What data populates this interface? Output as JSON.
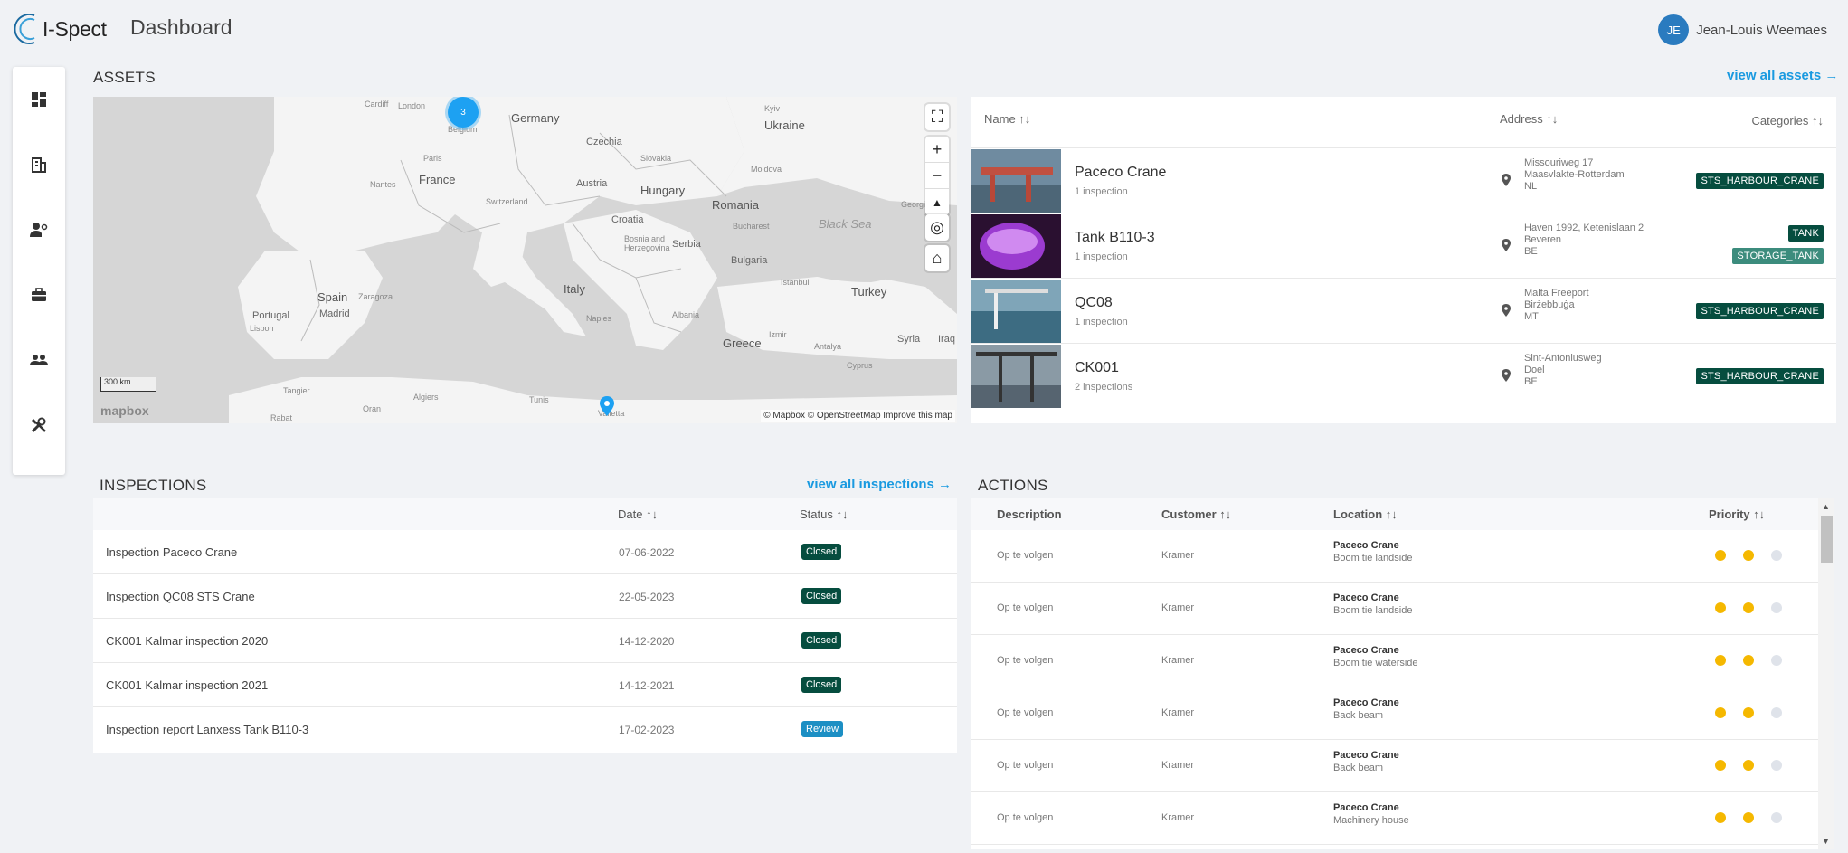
{
  "app": {
    "name": "I-Spect",
    "page_title": "Dashboard"
  },
  "user": {
    "initials": "JE",
    "name": "Jean-Louis Weemaes"
  },
  "sidebar": {
    "items": [
      {
        "name": "dashboard-icon",
        "glyph": "▦"
      },
      {
        "name": "buildings-icon",
        "glyph": "▥"
      },
      {
        "name": "user-settings-icon",
        "glyph": "👤"
      },
      {
        "name": "briefcase-icon",
        "glyph": "💼"
      },
      {
        "name": "users-icon",
        "glyph": "👥"
      },
      {
        "name": "tools-icon",
        "glyph": "🛠"
      }
    ]
  },
  "assets": {
    "title": "ASSETS",
    "view_all": "view all assets →",
    "columns": {
      "name": "Name ↑↓",
      "address": "Address ↑↓",
      "categories": "Categories ↑↓"
    },
    "rows": [
      {
        "name": "Paceco Crane",
        "sub": "1 inspection",
        "address": [
          "Missouriweg 17",
          "Maasvlakte-Rotterdam",
          "NL"
        ],
        "tags": [
          "STS_HARBOUR_CRANE"
        ]
      },
      {
        "name": "Tank B110-3",
        "sub": "1 inspection",
        "address": [
          "Haven 1992, Ketenislaan 2",
          "Beveren",
          "BE"
        ],
        "tags": [
          "TANK",
          "STORAGE_TANK"
        ]
      },
      {
        "name": "QC08",
        "sub": "1 inspection",
        "address": [
          "Malta Freeport",
          "Birżebbuġa",
          "MT"
        ],
        "tags": [
          "STS_HARBOUR_CRANE"
        ]
      },
      {
        "name": "CK001",
        "sub": "2 inspections",
        "address": [
          "Sint-Antoniusweg",
          "Doel",
          "BE"
        ],
        "tags": [
          "STS_HARBOUR_CRANE"
        ]
      }
    ]
  },
  "map": {
    "cluster_count": "3",
    "scale": "300 km",
    "logo": "mapbox",
    "attribution": "© Mapbox © OpenStreetMap  Improve this map",
    "labels": {
      "germany": "Germany",
      "ukraine": "Ukraine",
      "belgium": "Belgium",
      "london": "London",
      "cardiff": "Cardiff",
      "czechia": "Czechia",
      "slovakia": "Slovakia",
      "moldova": "Moldova",
      "paris": "Paris",
      "france": "France",
      "nantes": "Nantes",
      "austria": "Austria",
      "hungary": "Hungary",
      "switzerland": "Switzerland",
      "romania": "Romania",
      "croatia": "Croatia",
      "bucharest": "Bucharest",
      "black_sea": "Black Sea",
      "bosnia": "Bosnia and Herzegovina",
      "serbia": "Serbia",
      "bulgaria": "Bulgaria",
      "istanbul": "Istanbul",
      "spain": "Spain",
      "zaragoza": "Zaragoza",
      "madrid": "Madrid",
      "portugal": "Portugal",
      "lisbon": "Lisbon",
      "italy": "Italy",
      "turkey": "Turkey",
      "naples": "Naples",
      "albania": "Albania",
      "greece": "Greece",
      "izmir": "Izmir",
      "antalya": "Antalya",
      "syria": "Syria",
      "iraq": "Iraq",
      "cyprus": "Cyprus",
      "algiers": "Algiers",
      "tunis": "Tunis",
      "tangier": "Tangier",
      "oran": "Oran",
      "rabat": "Rabat",
      "kyiv": "Kyiv",
      "georgia": "Georgia",
      "valletta": "Valletta"
    }
  },
  "inspections": {
    "title": "INSPECTIONS",
    "view_all": "view all inspections →",
    "columns": {
      "date": "Date ↑↓",
      "status": "Status ↑↓"
    },
    "rows": [
      {
        "name": "Inspection Paceco Crane",
        "date": "07-06-2022",
        "status": "Closed"
      },
      {
        "name": "Inspection QC08 STS Crane",
        "date": "22-05-2023",
        "status": "Closed"
      },
      {
        "name": "CK001 Kalmar inspection 2020",
        "date": "14-12-2020",
        "status": "Closed"
      },
      {
        "name": "CK001 Kalmar inspection 2021",
        "date": "14-12-2021",
        "status": "Closed"
      },
      {
        "name": "Inspection report Lanxess Tank B110-3",
        "date": "17-02-2023",
        "status": "Review"
      }
    ],
    "status_colors": {
      "Closed": "#064d3f",
      "Review": "#1c8fc4"
    }
  },
  "actions": {
    "title": "ACTIONS",
    "columns": {
      "description": "Description",
      "customer": "Customer ↑↓",
      "location": "Location ↑↓",
      "priority": "Priority ↑↓"
    },
    "rows": [
      {
        "description": "Op te volgen",
        "customer": "Kramer",
        "location": "Paceco Crane",
        "sub": "Boom tie landside",
        "priority": 2
      },
      {
        "description": "Op te volgen",
        "customer": "Kramer",
        "location": "Paceco Crane",
        "sub": "Boom tie landside",
        "priority": 2
      },
      {
        "description": "Op te volgen",
        "customer": "Kramer",
        "location": "Paceco Crane",
        "sub": "Boom tie waterside",
        "priority": 2
      },
      {
        "description": "Op te volgen",
        "customer": "Kramer",
        "location": "Paceco Crane",
        "sub": "Back beam",
        "priority": 2
      },
      {
        "description": "Op te volgen",
        "customer": "Kramer",
        "location": "Paceco Crane",
        "sub": "Back beam",
        "priority": 2
      },
      {
        "description": "Op te volgen",
        "customer": "Kramer",
        "location": "Paceco Crane",
        "sub": "Machinery house",
        "priority": 2
      }
    ],
    "priority_max": 3
  },
  "colors": {
    "accent": "#1a9ae0",
    "tag_dark": "#064d3f",
    "priority_on": "#f5b800",
    "priority_off": "#dfe3ea"
  }
}
